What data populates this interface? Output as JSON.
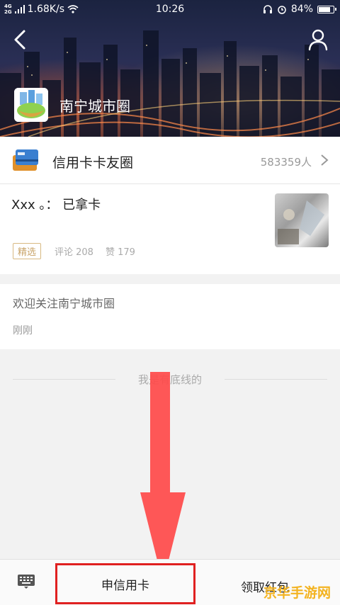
{
  "statusbar": {
    "network_top": "4G",
    "network_bottom": "2G",
    "speed": "1.68K/s",
    "time": "10:26",
    "battery": "84%",
    "battery_level": 0.84
  },
  "circle": {
    "name": "南宁城市圈"
  },
  "group": {
    "name": "信用卡卡友圈",
    "members": "583359人"
  },
  "post": {
    "title": "Xxx 。：  已拿卡",
    "tag": "精选",
    "comments": "评论 208",
    "likes": "赞 179"
  },
  "notice": {
    "text": "欢迎关注南宁城市圈",
    "time": "刚刚"
  },
  "footer_line": "我是有底线的",
  "toolbar": {
    "apply_label": "申信用卡",
    "redpack_label": "领取红包"
  },
  "watermark": "京华手游网",
  "colors": {
    "accent_red": "#e02020",
    "tag_gold": "#c9a46a",
    "watermark_gold": "#f3b320"
  },
  "icons": [
    "back-arrow-icon",
    "user-icon",
    "credit-card-icon",
    "chevron-right-icon",
    "keyboard-icon",
    "wifi-icon",
    "headphones-icon",
    "alarm-icon"
  ]
}
